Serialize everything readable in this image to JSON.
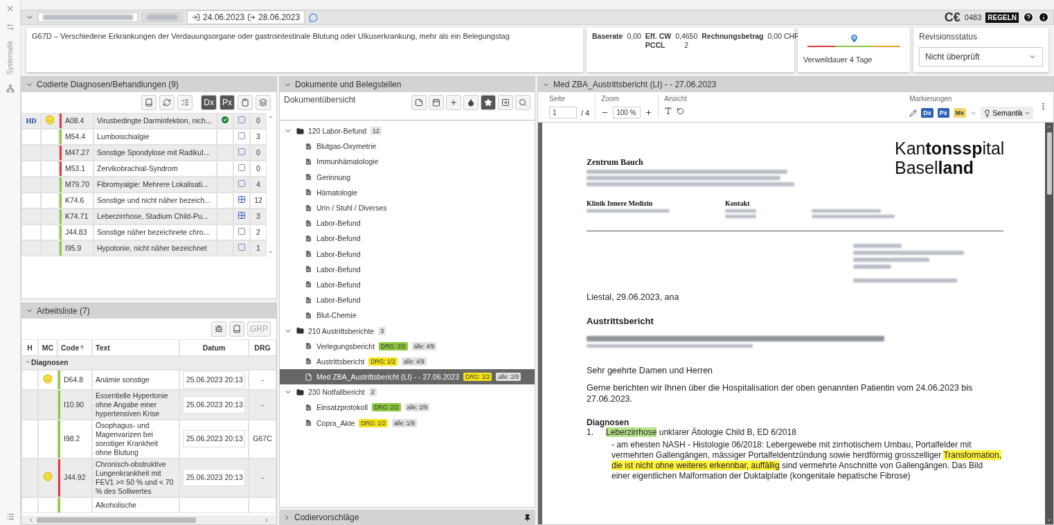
{
  "sidebar": {
    "label": "Systematik"
  },
  "header": {
    "admission": "24.06.2023",
    "discharge": "28.06.2023",
    "ce_label": "C€",
    "ce_number": "0483",
    "rules_badge": "REGELN"
  },
  "drg": {
    "text": "G67D – Verschiedene Erkrankungen der Verdauungsorgane oder gastrointestinale Blutung oder Ulkuserkrankung, mehr als ein Belegungstag"
  },
  "billing": {
    "baserate_label": "Baserate",
    "baserate": "0,00",
    "cw_label": "Eff. CW",
    "cw": "0,4650",
    "pccl_label": "PCCL",
    "pccl": "2",
    "amount_label": "Rechnungsbetrag",
    "amount": "0,00 CHF"
  },
  "stay": {
    "label": "Verweildauer 4 Tage",
    "level": 0.5
  },
  "revision": {
    "label": "Revisionsstatus",
    "value": "Nicht überprüft"
  },
  "coded": {
    "title": "Codierte Diagnosen/Behandlungen (9)",
    "toggles": [
      {
        "label": "Dx",
        "selected": true
      },
      {
        "label": "Px",
        "selected": true
      }
    ],
    "rows": [
      {
        "hd": "HD",
        "mood": true,
        "color": "#e0383e",
        "code": "A08.4",
        "text": "Virusbedingte Darminfektion, nich...",
        "confirmed": true,
        "marked": false,
        "count": "0"
      },
      {
        "mood": false,
        "color": "#8cc63f",
        "code": "M54.4",
        "text": "Lumboischialgie",
        "confirmed": false,
        "marked": false,
        "count": "3"
      },
      {
        "mood": false,
        "color": "#e0383e",
        "code": "M47.27",
        "text": "Sonstige Spondylose mit Radikul...",
        "confirmed": false,
        "marked": false,
        "count": "0"
      },
      {
        "mood": false,
        "color": "#e0383e",
        "code": "M53.1",
        "text": "Zervikobrachial-Syndrom",
        "confirmed": false,
        "marked": false,
        "count": "0"
      },
      {
        "mood": false,
        "color": "#8cc63f",
        "code": "M79.70",
        "text": "Fibromyalgie: Mehrere Lokalisati...",
        "confirmed": false,
        "marked": false,
        "count": "4"
      },
      {
        "mood": false,
        "color": "#8cc63f",
        "code": "K74.6",
        "text": "Sonstige und nicht näher bezeich...",
        "confirmed": false,
        "marked": true,
        "count": "12"
      },
      {
        "mood": false,
        "color": "#8cc63f",
        "code": "K74.71",
        "text": "Leberzirrhose, Stadium Child-Pu...",
        "confirmed": false,
        "marked": true,
        "count": "3"
      },
      {
        "mood": false,
        "color": "#8cc63f",
        "code": "J44.83",
        "text": "Sonstige näher bezeichnete chro...",
        "confirmed": false,
        "marked": false,
        "count": "2"
      },
      {
        "mood": false,
        "color": "#8cc63f",
        "code": "I95.9",
        "text": "Hypotonie, nicht näher bezeichnet",
        "confirmed": false,
        "marked": false,
        "count": "1"
      }
    ]
  },
  "worklist": {
    "title": "Arbeitsliste (7)",
    "grp_button": "GRP",
    "columns": [
      {
        "label": "H",
        "sorted": false
      },
      {
        "label": "MC",
        "sorted": false
      },
      {
        "label": "Code",
        "sorted": true
      },
      {
        "label": "Text",
        "sorted": false
      },
      {
        "label": "Datum",
        "sorted": false
      },
      {
        "label": "DRG",
        "sorted": false
      }
    ],
    "group": {
      "label": "Diagnosen",
      "expanded": true
    },
    "rows": [
      {
        "mood": true,
        "color": "#8cc63f",
        "code": "D64.8",
        "text": "Anämie sonstige",
        "date": "25.06.2023 20:13",
        "drg": "-"
      },
      {
        "mood": false,
        "color": "#8cc63f",
        "code": "I10.90",
        "text": "Essentielle Hypertonie ohne Angabe einer hypertensiven Krise",
        "date": "25.06.2023 20:13",
        "drg": "-"
      },
      {
        "mood": false,
        "color": "#8cc63f",
        "code": "I98.2",
        "text": "Ösophagus- und Magenvarizen bei sonstiger Krankheit ohne Blutung",
        "date": "25.06.2023 20:13",
        "drg": "G67C"
      },
      {
        "mood": true,
        "color": "#e0383e",
        "code": "J44.92",
        "text": "Chronisch-obstruktive Lungenkrankheit mit FEV1 >= 50 % und < 70 % des Sollwertes",
        "date": "25.06.2023 20:13",
        "drg": "-"
      },
      {
        "mood": false,
        "color": "#8cc63f",
        "text": "Alkoholische"
      }
    ]
  },
  "documents": {
    "title": "Dokumente und Belegstellen",
    "subtitle": "Dokumentübersicht",
    "toolbar": [
      {
        "kind": "note",
        "selected": false
      },
      {
        "kind": "calendar",
        "selected": false
      },
      {
        "kind": "plus",
        "selected": false
      },
      {
        "kind": "drop",
        "selected": false
      },
      {
        "kind": "star",
        "selected": true
      },
      {
        "kind": "export",
        "selected": false
      },
      {
        "kind": "search",
        "selected": false
      }
    ],
    "tree": [
      {
        "label": "120 Labor-Befund",
        "count": "12",
        "expanded": true,
        "children": [
          {
            "label": "Blutgas-Oxymetrie",
            "selected": false
          },
          {
            "label": "Immunhämatologie",
            "selected": false
          },
          {
            "label": "Gerinnung",
            "selected": false
          },
          {
            "label": "Hämatologie",
            "selected": false
          },
          {
            "label": "Urin / Stuhl / Diverses",
            "selected": false
          },
          {
            "label": "Labor-Befund",
            "selected": false
          },
          {
            "label": "Labor-Befund",
            "selected": false
          },
          {
            "label": "Labor-Befund",
            "selected": false
          },
          {
            "label": "Labor-Befund",
            "selected": false
          },
          {
            "label": "Labor-Befund",
            "selected": false
          },
          {
            "label": "Labor-Befund",
            "selected": false
          },
          {
            "label": "Blut-Chemie",
            "selected": false
          }
        ]
      },
      {
        "label": "210 Austrittsberichte",
        "count": "3",
        "expanded": true,
        "children": [
          {
            "label": "Verlegungsbericht",
            "selected": false,
            "drg": "DRG: 2/2",
            "color": "#8cc63f",
            "all": "alle: 4/9"
          },
          {
            "label": "Austrittsbericht",
            "selected": false,
            "drg": "DRG: 1/2",
            "color": "#f5e21b",
            "all": "alle: 4/9"
          },
          {
            "label": "Med ZBA_Austrittsbericht (LI) - - 27.06.2023",
            "selected": true,
            "drg": "DRG: 1/2",
            "color": "#f5e21b",
            "all": "alle: 2/9"
          }
        ]
      },
      {
        "label": "230 Notfallbericht",
        "count": "2",
        "expanded": true,
        "children": [
          {
            "label": "Einsatzprotokoll",
            "selected": false,
            "drg": "DRG: 2/2",
            "color": "#8cc63f",
            "all": "alle: 2/9"
          },
          {
            "label": "Copra_Akte",
            "selected": false,
            "drg": "DRG: 1/2",
            "color": "#f5e21b",
            "all": "alle: 1/9"
          }
        ]
      }
    ]
  },
  "suggestions": {
    "title": "Codiervorschläge",
    "expanded": false
  },
  "viewer": {
    "title": "Med ZBA_Austrittsbericht (LI) - - 27.06.2023",
    "page_label": "Seite",
    "page": "1",
    "page_total": "/ 4",
    "zoom_label": "Zoom",
    "zoom": "100 %",
    "view_label": "Ansicht",
    "marks_label": "Markierungen",
    "mark_buttons": [
      {
        "label": "Dx",
        "color": "#2f62b8"
      },
      {
        "label": "Px",
        "color": "#2f62b8"
      },
      {
        "label": "Mx",
        "color": "#f3d66a"
      }
    ],
    "semantics": "Semantik"
  },
  "document": {
    "center": "Zentrum Bauch",
    "logo": [
      "Kan**tonssp**ital",
      "Basel**land**"
    ],
    "clinic": "Klinik Innere Medizin",
    "contact": "Kontakt",
    "place_date": "Liestal, 29.06.2023,  ana",
    "heading": "Austrittsbericht",
    "salutation": "Sehr geehrte Damen und Herren",
    "intro": "Gerne berichten wir Ihnen über die Hospitalisation der oben genannten Patientin vom 24.06.2023 bis 27.06.2023.",
    "diagnoses_heading": "Diagnosen",
    "diagnoses": [
      {
        "number": "1.",
        "title": [
          {
            "text": "Leberzirrhose",
            "color": "#b9e28b"
          },
          {
            "text": " unklarer Ätiologie Child B, ED 6/2018"
          }
        ],
        "detail": [
          {
            "text": "- am ehesten NASH - Histologie 06/2018: Lebergewebe mit zirrhotischem Umbau, Portalfelder mit vermehrten Gallengängen, mässiger Portalfeldentzündung sowie herdförmig grosszelliger "
          },
          {
            "text": "Transformation, die ist nicht ohne weiteres erkennbar, auffällig",
            "color": "#fff23a"
          },
          {
            "text": " sind vermehrte Anschnitte von Gallengängen. Das Bild einer eigentlichen Malformation der Duktalplatte (kongenitale hepatische Fibrose)"
          }
        ]
      }
    ]
  }
}
